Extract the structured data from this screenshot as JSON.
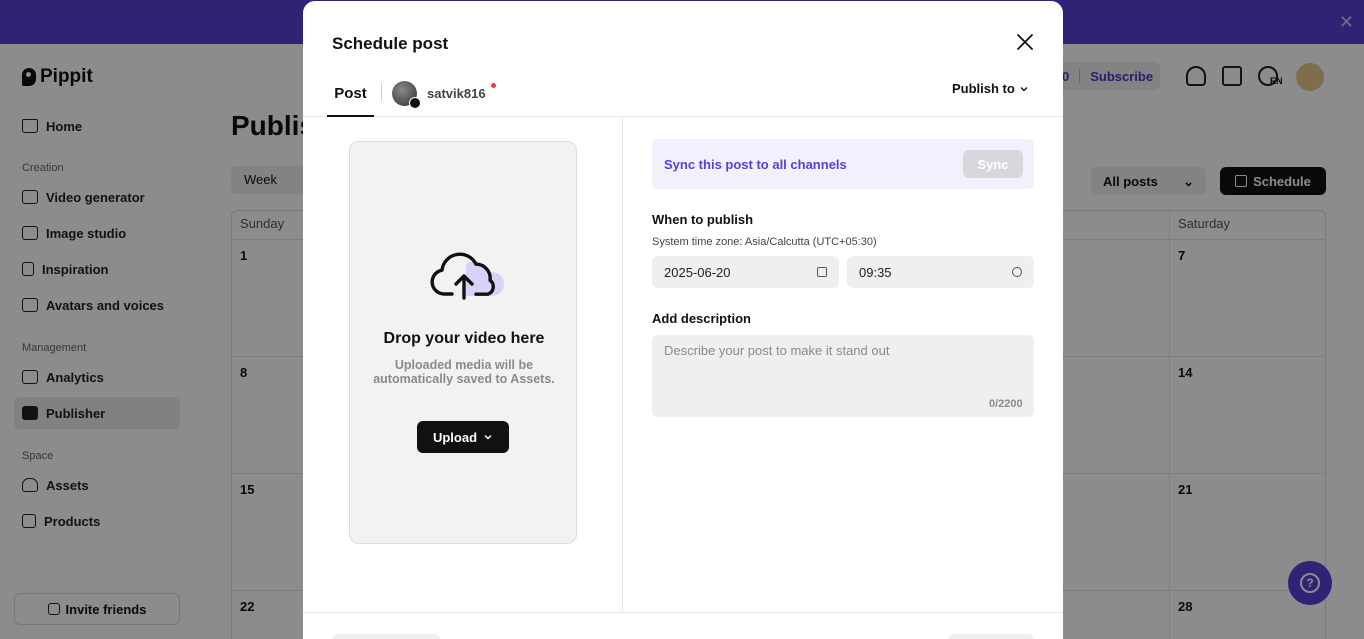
{
  "app": {
    "brand": "Pippit",
    "banner_close": "✕",
    "sidebar": {
      "home": "Home",
      "sections": {
        "creation": "Creation",
        "management": "Management",
        "space": "Space"
      },
      "items": [
        {
          "label": "Video generator"
        },
        {
          "label": "Image studio"
        },
        {
          "label": "Inspiration"
        },
        {
          "label": "Avatars and voices"
        },
        {
          "label": "Analytics"
        },
        {
          "label": "Publisher"
        },
        {
          "label": "Assets"
        },
        {
          "label": "Products"
        }
      ],
      "invite": "Invite friends"
    },
    "page_title_partial": "Publis",
    "week_toggle": "Week",
    "header": {
      "credits": "0",
      "subscribe": "Subscribe",
      "lang": "EN"
    },
    "filter": "All posts",
    "schedule": "Schedule",
    "calendar": {
      "days": [
        "Sunday",
        "Saturday"
      ],
      "sunday_dates": [
        "1",
        "8",
        "15",
        "22"
      ],
      "saturday_dates": [
        "7",
        "14",
        "21",
        "28"
      ]
    },
    "help": "?"
  },
  "modal": {
    "title": "Schedule post",
    "tab_post": "Post",
    "account": "satvik816",
    "publish_to": "Publish to",
    "dropzone": {
      "title": "Drop your video here",
      "subtitle": "Uploaded media will be automatically saved to Assets.",
      "upload": "Upload"
    },
    "sync": {
      "text": "Sync this post to all channels",
      "button": "Sync"
    },
    "when": {
      "label": "When to publish",
      "timezone": "System time zone: Asia/Calcutta (UTC+05:30)",
      "date": "2025-06-20",
      "time": "09:35"
    },
    "description": {
      "label": "Add description",
      "placeholder": "Describe your post to make it stand out",
      "counter": "0/2200"
    }
  }
}
